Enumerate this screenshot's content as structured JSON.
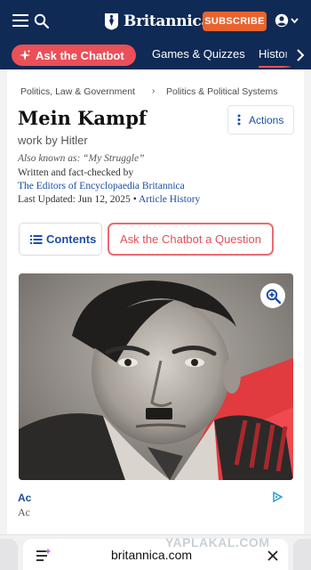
{
  "header": {
    "brand_name": "Britannica",
    "subscribe_label": "SUBSCRIBE",
    "menu_icon": "hamburger-menu-icon",
    "search_icon": "search-icon",
    "account_icon": "account-icon",
    "colors": {
      "navy": "#0f2a55",
      "subscribe": "#e8632e"
    }
  },
  "subnav": {
    "chatbot_label": "Ask the Chatbot",
    "games_label": "Games & Quizzes",
    "history_label": "History",
    "colors": {
      "chatbot": "#eb4f58"
    }
  },
  "article": {
    "breadcrumb": [
      "Politics, Law & Government",
      "Politics & Political Systems"
    ],
    "breadcrumb_sep": "›",
    "title": "Mein Kampf",
    "subtitle": "work by Hitler",
    "also_known": "Also known as: “My Struggle”",
    "written_by": "Written and fact-checked by",
    "editors": "The Editors of Encyclopaedia Britannica",
    "last_updated": "Last Updated: Jun 12, 2025",
    "bullet": " • ",
    "article_history": "Article History",
    "actions_label": "Actions",
    "contents_label": "Contents",
    "ask_chatbot_question": "Ask the Chatbot a Question",
    "link_color": "#1c4fa3"
  },
  "ad": {
    "line1": "Ac",
    "line2": "Ac"
  },
  "browser": {
    "url": "britannica.com",
    "watermark": "YAPLAKAL.COM"
  }
}
